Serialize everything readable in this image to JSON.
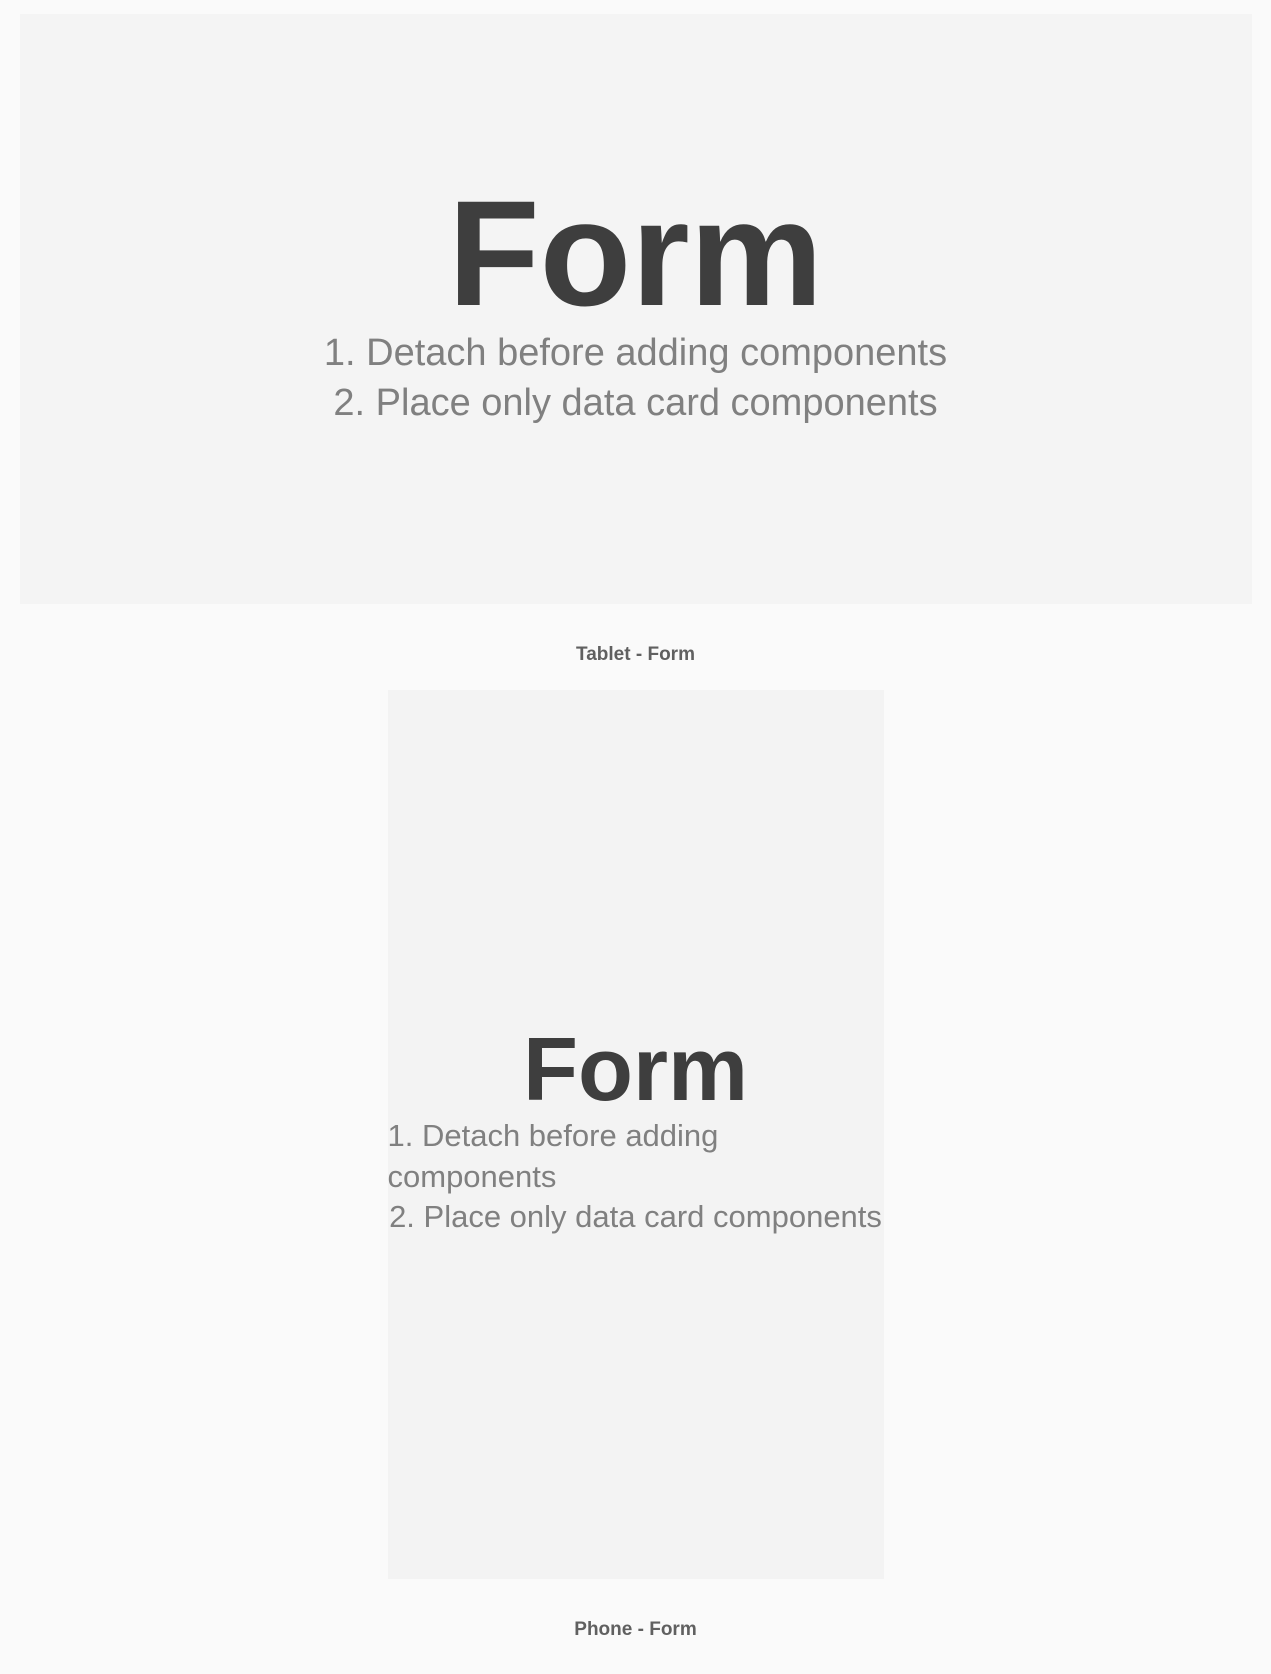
{
  "tablet": {
    "title": "Form",
    "instruction1": "1. Detach before adding components",
    "instruction2": "2. Place only data card components",
    "caption": "Tablet - Form"
  },
  "phone": {
    "title": "Form",
    "instruction1": "1. Detach before adding components",
    "instruction2": "2. Place only data card components",
    "caption": "Phone - Form"
  }
}
